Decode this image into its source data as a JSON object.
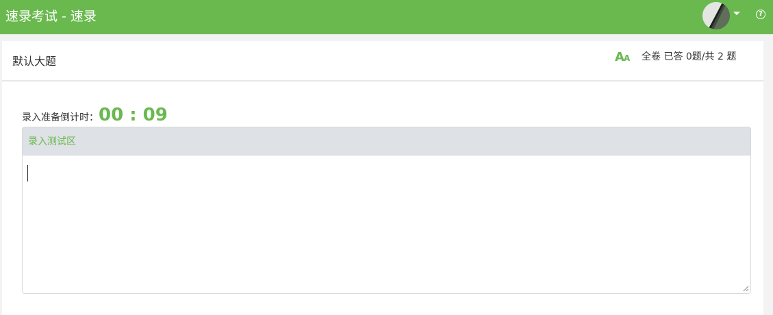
{
  "header": {
    "title": "速录考试 - 速录",
    "avatar_icon": "user-avatar",
    "menu_icon": "caret-down-icon",
    "help_glyph": "?",
    "accent_color": "#6ab94f"
  },
  "section": {
    "title": "默认大题",
    "font_toggle_big": "A",
    "font_toggle_small": "A",
    "progress": "全卷 已答 0题/共 2 题"
  },
  "countdown": {
    "label": "录入准备倒计时：",
    "value": "00 : 09"
  },
  "typing_area": {
    "title": "录入测试区",
    "value": "",
    "placeholder": ""
  }
}
